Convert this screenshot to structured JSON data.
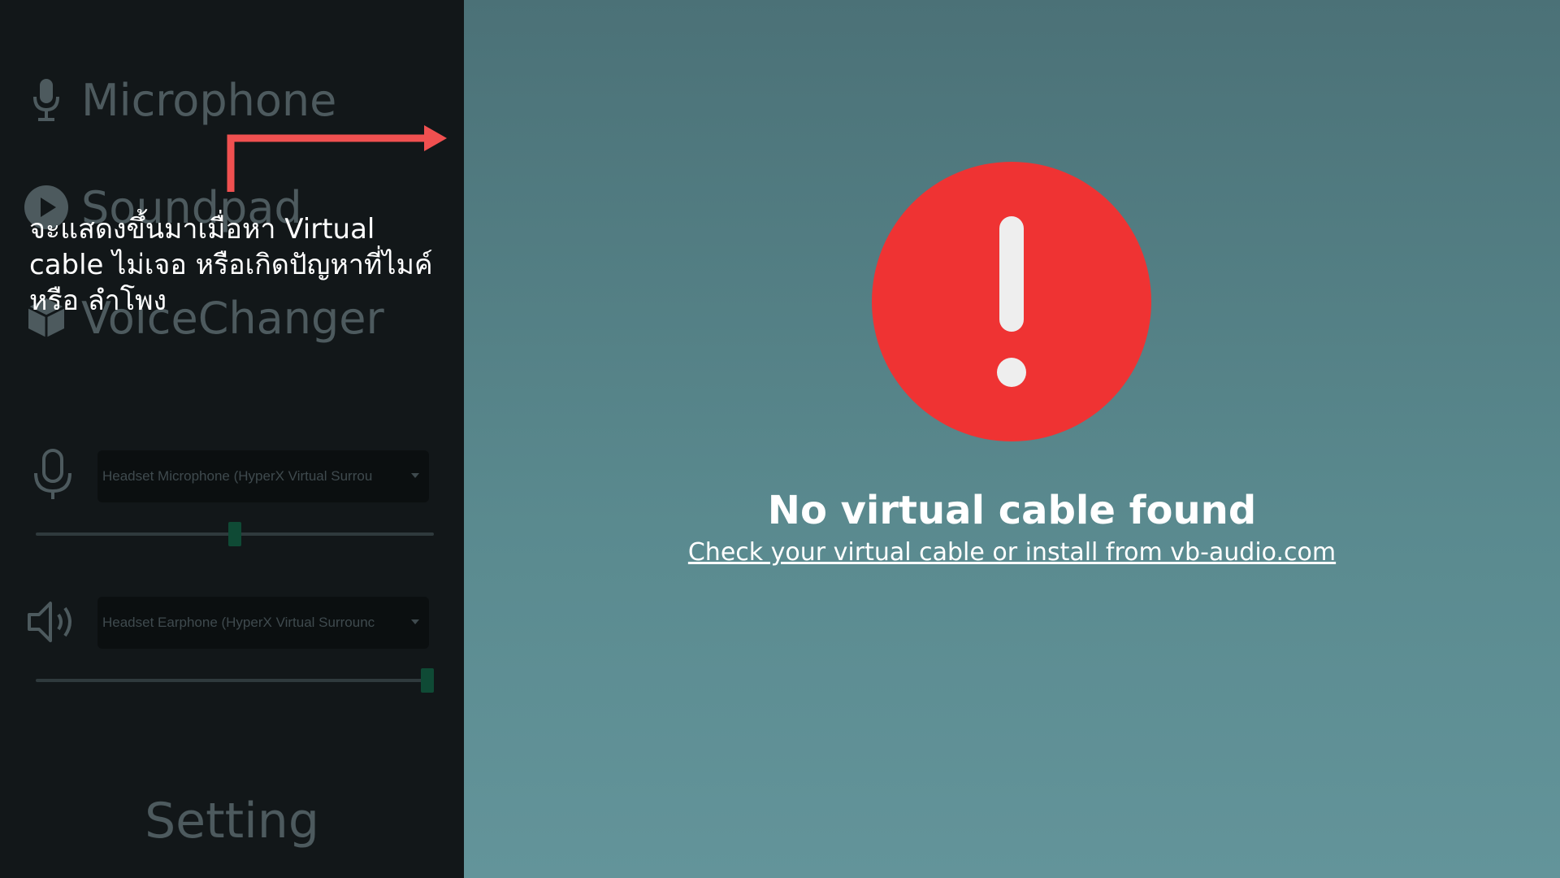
{
  "sidebar": {
    "nav": [
      {
        "label": "Microphone",
        "icon": "microphone-icon"
      },
      {
        "label": "Soundpad",
        "icon": "play-icon"
      },
      {
        "label": "VoiceChanger",
        "icon": "cube-icon"
      }
    ],
    "devices": {
      "input": {
        "icon": "microphone-outline-icon",
        "selected": "Headset Microphone (HyperX Virtual Surrou",
        "volume": 0.5
      },
      "output": {
        "icon": "speaker-icon",
        "selected": "Headset Earphone (HyperX Virtual Surrounc",
        "volume": 1.0
      }
    },
    "setting_label": "Setting"
  },
  "annotation": {
    "text": "จะแสดงขึ้นมาเมื่อหา Virtual cable ไม่เจอ หรือเกิดปัญหาที่ไมค์ หรือ ลำโพง",
    "color": "#ffffff",
    "arrow_color": "#f05050"
  },
  "main": {
    "icon": "alert-icon",
    "title": "No virtual cable found",
    "link_text": "Check your virtual cable or install from vb-audio.com",
    "alert_color": "#ef3333"
  },
  "colors": {
    "sidebar_bg": "#121719",
    "main_bg_top": "#4b7177",
    "main_bg_bottom": "#63949a",
    "slider_thumb": "#0f4a35"
  }
}
